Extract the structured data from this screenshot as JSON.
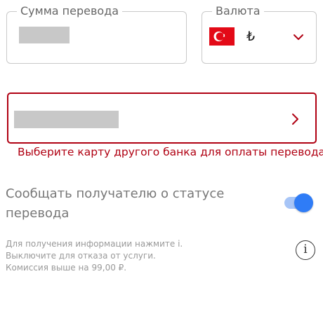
{
  "amount_field": {
    "legend": "Сумма перевода"
  },
  "currency_field": {
    "legend": "Валюта",
    "flag": "turkey-flag-icon",
    "symbol": "₺",
    "dropdown_icon": "chevron-down-icon"
  },
  "card_select": {
    "arrow_icon": "chevron-right-icon",
    "error_text": "Выберите карту другого банка для оплаты перевода"
  },
  "notify": {
    "label": "Сообщать получателю о статусе перевода",
    "toggle_on": true
  },
  "info": {
    "lines": [
      "Для получения информации нажмите i.",
      "Выключите для отказа от услуги.",
      "Комиссия выше на 99,00 ₽."
    ],
    "icon": "info-icon",
    "icon_glyph": "i"
  },
  "colors": {
    "error": "#b00012",
    "accent": "#2f7cf6",
    "flag_red": "#e30a17"
  }
}
